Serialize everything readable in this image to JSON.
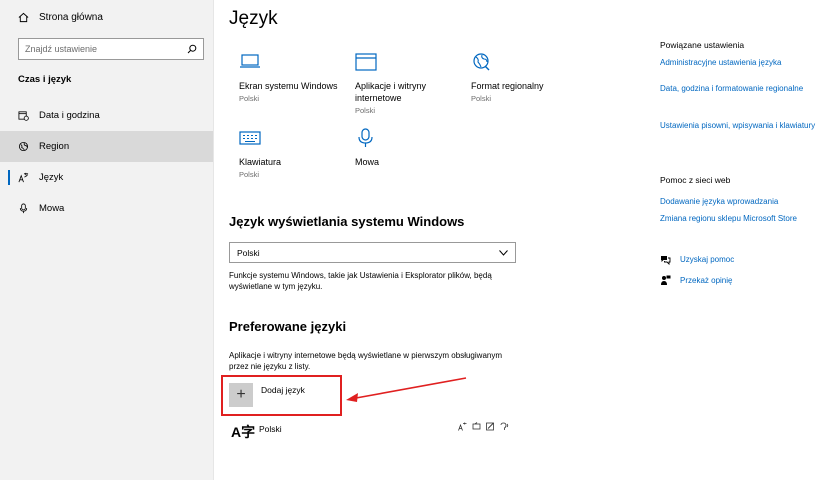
{
  "sidebar": {
    "home_label": "Strona główna",
    "search_placeholder": "Znajdź ustawienie",
    "section_title": "Czas i język",
    "items": [
      {
        "label": "Data i godzina"
      },
      {
        "label": "Region"
      },
      {
        "label": "Język"
      },
      {
        "label": "Mowa"
      }
    ]
  },
  "main": {
    "title": "Język",
    "tiles": [
      {
        "label": "Ekran systemu Windows",
        "sub": "Polski"
      },
      {
        "label": "Aplikacje i witryny internetowe",
        "sub": "Polski"
      },
      {
        "label": "Format regionalny",
        "sub": "Polski"
      },
      {
        "label": "Klawiatura",
        "sub": "Polski"
      },
      {
        "label": "Mowa",
        "sub": ""
      }
    ],
    "display_lang_heading": "Język wyświetlania systemu Windows",
    "display_lang_value": "Polski",
    "display_lang_desc": "Funkcje systemu Windows, takie jak Ustawienia i Eksplorator plików, będą wyświetlane w tym języku.",
    "preferred_heading": "Preferowane języki",
    "preferred_desc": "Aplikacje i witryny internetowe będą wyświetlane w pierwszym obsługiwanym przez nie języku z listy.",
    "add_language_label": "Dodaj język",
    "add_language_symbol": "+",
    "installed_language": "Polski",
    "installed_language_glyph": "A字"
  },
  "rail": {
    "related_title": "Powiązane ustawienia",
    "related_links": [
      "Administracyjne ustawienia języka",
      "Data, godzina i formatowanie regionalne",
      "Ustawienia pisowni, wpisywania i klawiatury"
    ],
    "help_title": "Pomoc z sieci web",
    "help_links": [
      "Dodawanie języka wprowadzania",
      "Zmiana regionu sklepu Microsoft Store"
    ],
    "get_help": "Uzyskaj pomoc",
    "feedback": "Przekaż opinię"
  },
  "colors": {
    "accent": "#0067c0",
    "annotation": "#e02020",
    "sidebar_bg": "#f2f2f2"
  }
}
